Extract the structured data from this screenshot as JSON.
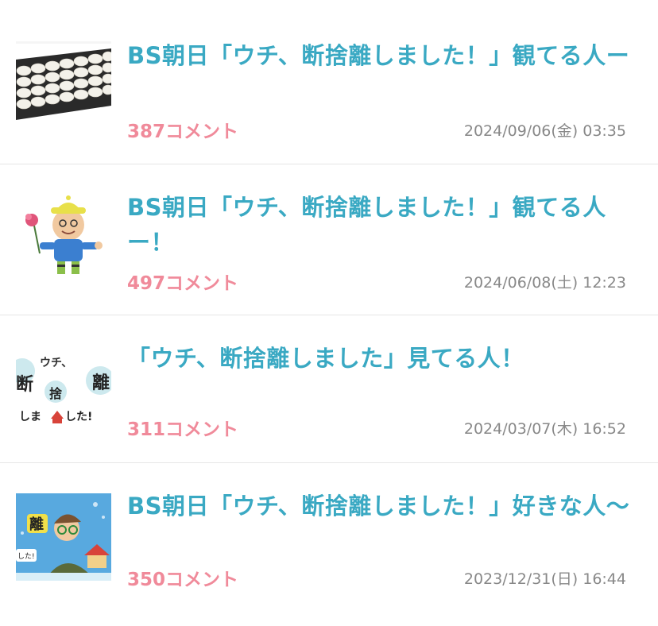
{
  "threads": [
    {
      "title": "BS朝日「ウチ、断捨離しました！」観てる人ー",
      "comments": "387コメント",
      "date": "2024/09/06(金) 03:35",
      "thumbnail": "white-dumplings-tray"
    },
    {
      "title": "BS朝日「ウチ、断捨離しました！」観てる人ー！",
      "comments": "497コメント",
      "date": "2024/06/08(土) 12:23",
      "thumbnail": "mascot-figure-with-flower"
    },
    {
      "title": "「ウチ、断捨離しました」見てる人！",
      "comments": "311コメント",
      "date": "2024/03/07(木) 16:52",
      "thumbnail": "show-logo-graphic"
    },
    {
      "title": "BS朝日「ウチ、断捨離しました！」好きな人〜",
      "comments": "350コメント",
      "date": "2023/12/31(日) 16:44",
      "thumbnail": "illustrated-man-with-house"
    }
  ]
}
